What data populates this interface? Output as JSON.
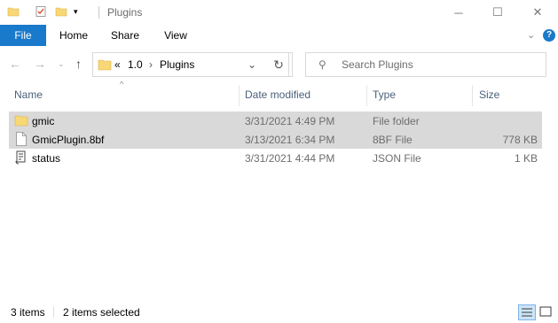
{
  "window": {
    "title": "Plugins"
  },
  "ribbon": {
    "file": "File",
    "home": "Home",
    "share": "Share",
    "view": "View"
  },
  "address": {
    "overflow": "«",
    "seg1": "1.0",
    "sep": "›",
    "seg2": "Plugins"
  },
  "search": {
    "placeholder": "Search Plugins"
  },
  "columns": {
    "name": "Name",
    "date": "Date modified",
    "type": "Type",
    "size": "Size"
  },
  "files": [
    {
      "name": "gmic",
      "date": "3/31/2021 4:49 PM",
      "type": "File folder",
      "size": "",
      "selected": true,
      "icon": "folder-icon"
    },
    {
      "name": "GmicPlugin.8bf",
      "date": "3/13/2021 6:34 PM",
      "type": "8BF File",
      "size": "778 KB",
      "selected": true,
      "icon": "file-icon"
    },
    {
      "name": "status",
      "date": "3/31/2021 4:44 PM",
      "type": "JSON File",
      "size": "1 KB",
      "selected": false,
      "icon": "json-file-icon"
    }
  ],
  "status": {
    "count": "3 items",
    "selected": "2 items selected"
  },
  "colors": {
    "accent": "#1979ca",
    "selection": "#d9d9d9",
    "header": "#4c607a"
  }
}
